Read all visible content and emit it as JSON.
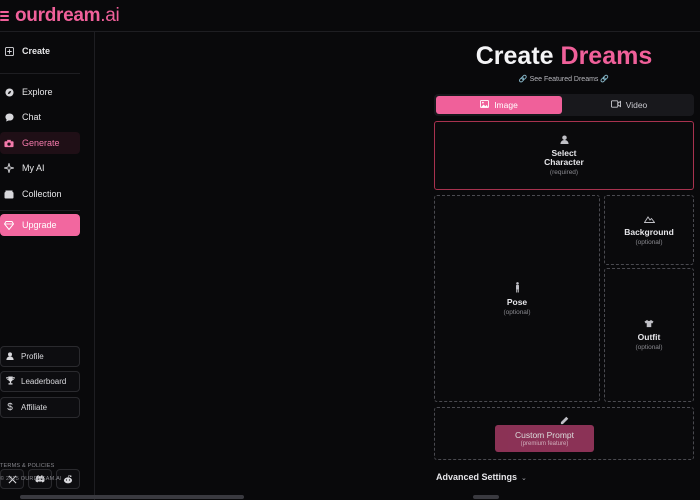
{
  "header": {
    "logo_main": "ourdream",
    "logo_suffix": ".ai",
    "menu_icon": "hamburger-icon"
  },
  "sidebar": {
    "create": {
      "label": "Create",
      "icon": "plus-square-icon"
    },
    "items": [
      {
        "label": "Explore",
        "icon": "compass-icon"
      },
      {
        "label": "Chat",
        "icon": "chat-bubble-icon"
      },
      {
        "label": "Generate",
        "icon": "camera-icon",
        "active": true
      },
      {
        "label": "My AI",
        "icon": "sparkle-icon"
      },
      {
        "label": "Collection",
        "icon": "folder-icon"
      }
    ],
    "upgrade": {
      "label": "Upgrade",
      "icon": "gem-icon"
    },
    "bottom_buttons": [
      {
        "label": "Profile",
        "icon": "user-icon"
      },
      {
        "label": "Leaderboard",
        "icon": "trophy-icon"
      },
      {
        "label": "Affiliate",
        "icon": "dollar-icon"
      }
    ],
    "socials": [
      "x-icon",
      "discord-icon",
      "reddit-icon"
    ],
    "terms": "TERMS & POLICIES",
    "copyright": "© 2025 OURDREAM.AI"
  },
  "main": {
    "title_part1": "Create ",
    "title_part2": "Dreams",
    "featured_link": "See Featured Dreams",
    "tabs": [
      {
        "label": "Image",
        "icon": "image-icon",
        "selected": true
      },
      {
        "label": "Video",
        "icon": "video-icon",
        "selected": false
      }
    ],
    "cards": {
      "character": {
        "label_line1": "Select",
        "label_line2": "Character",
        "sub": "(required)",
        "icon": "user-icon"
      },
      "pose": {
        "label": "Pose",
        "sub": "(optional)",
        "icon": "figure-icon"
      },
      "background": {
        "label": "Background",
        "sub": "(optional)",
        "icon": "mountain-icon"
      },
      "outfit": {
        "label": "Outfit",
        "sub": "(optional)",
        "icon": "shirt-icon"
      },
      "prompt": {
        "label": "Custom Prompt",
        "sub": "(premium feature)",
        "icon": "pencil-icon"
      }
    },
    "advanced": "Advanced Settings"
  },
  "colors": {
    "accent": "#f0609a",
    "background": "#09090b",
    "required_border": "#a8324f"
  }
}
